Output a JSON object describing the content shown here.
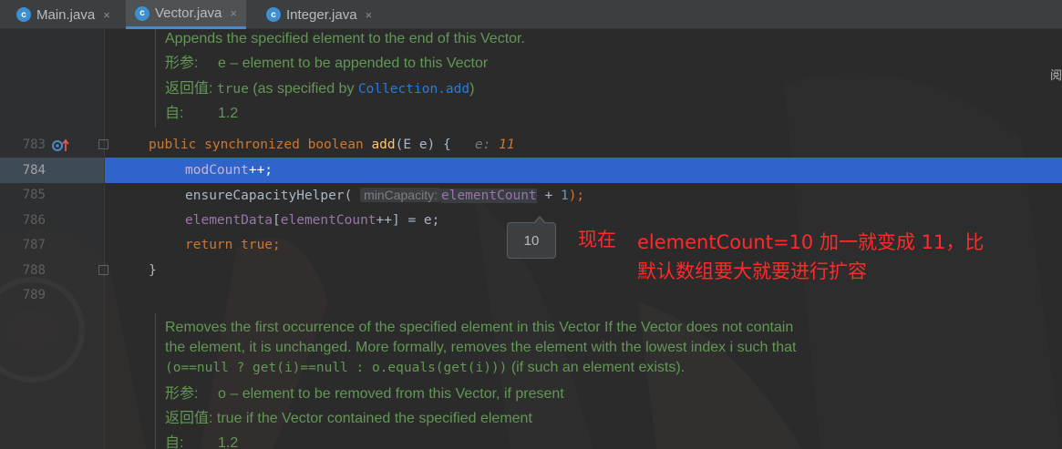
{
  "tabs": [
    {
      "label": "Main.java",
      "icon": "java-class-icon",
      "close": "×"
    },
    {
      "label": "Vector.java",
      "icon": "java-class-icon",
      "close": "×"
    },
    {
      "label": "Integer.java",
      "icon": "java-class-icon",
      "close": "×"
    }
  ],
  "doc_top": {
    "line1": "Appends the specified element to the end of this Vector.",
    "params_label": "形参:",
    "params_text": "e – element to be appended to this Vector",
    "returns_label": "返回值:",
    "returns_mono": "true",
    "returns_text": " (as specified by ",
    "returns_link": "Collection.add",
    "returns_close": ")",
    "since_label": "自:",
    "since_text": "1.2"
  },
  "line_numbers": [
    "783",
    "784",
    "785",
    "786",
    "787",
    "788",
    "789"
  ],
  "code": {
    "l783_kw1": "public synchronized boolean ",
    "l783_fn": "add",
    "l783_rest": "(E e) {",
    "l783_inline_label": "e: ",
    "l783_inline_val": "11",
    "l784_field": "modCount",
    "l784_rest": "++;",
    "l785_call": "ensureCapacityHelper(",
    "l785_hint": "minCapacity:",
    "l785_field": "elementCount",
    "l785_plus": " + ",
    "l785_num": "1",
    "l785_close": ");",
    "l786_field1": "elementData",
    "l786_b1": "[",
    "l786_field2": "elementCount",
    "l786_b2": "++] = e;",
    "l787_kw": "return true;",
    "l788_brace": "}"
  },
  "tooltip_value": "10",
  "annotation": {
    "line1_a": "现在",
    "line1_b": "elementCount=10 加一就变成 11，比",
    "line2": "默认数组要大就要进行扩容",
    "color": "#ff2a2a"
  },
  "doc_bottom": {
    "line1": "Removes the first occurrence of the specified element in this Vector If the Vector does not contain",
    "line2": "the element, it is unchanged. More formally, removes the element with the lowest index i such that",
    "line3_mono": "(o==null ? get(i)==null : o.equals(get(i)))",
    "line3_text": " (if such an element exists).",
    "params_label": "形参:",
    "params_text": "o – element to be removed from this Vector, if present",
    "returns_label": "返回值:",
    "returns_text": "true if the Vector contained the specified element",
    "since_label": "自:",
    "since_text": "1.2"
  },
  "corner_text": "阅",
  "colors": {
    "accent": "#2f65ca",
    "keyword": "#cc7832",
    "function": "#ffc66d",
    "field": "#9876aa",
    "doc": "#629755",
    "link": "#287bde"
  }
}
